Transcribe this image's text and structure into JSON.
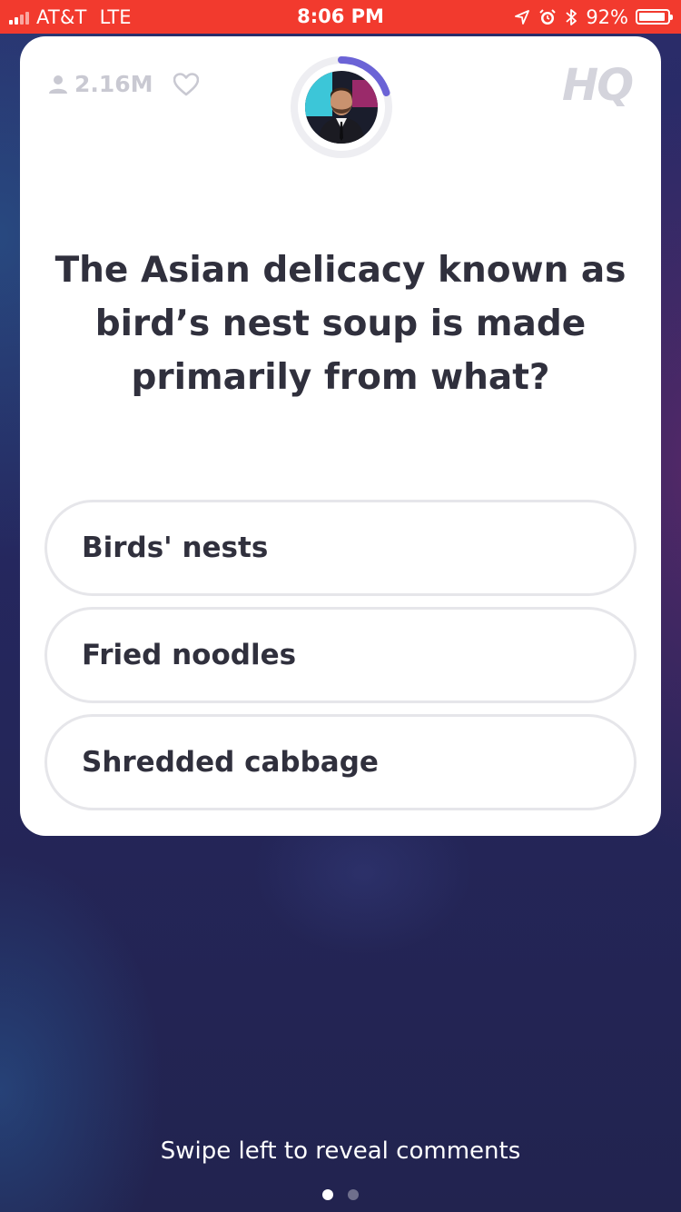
{
  "status_bar": {
    "carrier": "AT&T",
    "network": "LTE",
    "time": "8:06 PM",
    "battery_percent": "92%",
    "battery_level": 0.92,
    "icons": [
      "location-arrow-icon",
      "alarm-icon",
      "bluetooth-icon",
      "battery-icon"
    ],
    "background_color": "#f23a2e"
  },
  "card": {
    "viewer_count": "2.16M",
    "logo": "HQ",
    "timer_progress": 0.2,
    "timer_color": "#6b63d6",
    "question": "The Asian delicacy known as bird’s nest soup is made primarily from what?",
    "answers": [
      {
        "label": "Birds' nests"
      },
      {
        "label": "Fried noodles"
      },
      {
        "label": "Shredded cabbage"
      }
    ]
  },
  "footer": {
    "swipe_hint": "Swipe left to reveal comments",
    "page_count": 2,
    "active_page": 1
  }
}
